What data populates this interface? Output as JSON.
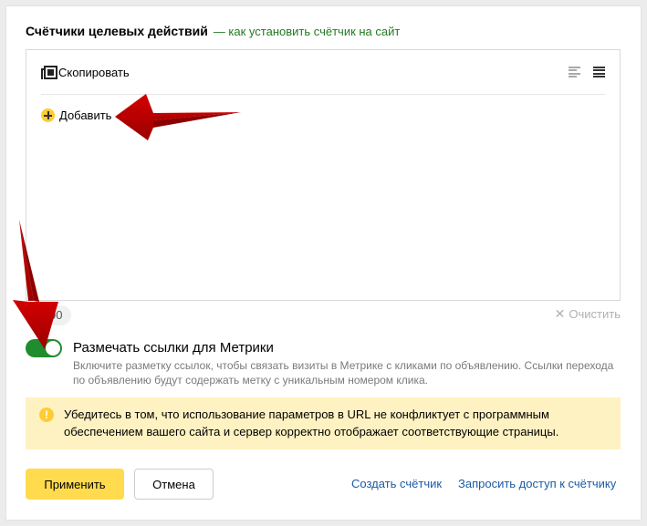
{
  "header": {
    "title": "Счётчики целевых действий",
    "link": "— как установить счётчик на сайт"
  },
  "editor": {
    "copy_label": "Скопировать",
    "add_label": "Добавить",
    "view_icons": [
      "align-left-icon",
      "align-justify-icon"
    ]
  },
  "counter": {
    "value": "00",
    "clear_label": "Очистить"
  },
  "toggle": {
    "label": "Размечать ссылки для Метрики",
    "on": true,
    "description": "Включите разметку ссылок, чтобы связать визиты в Метрике с кликами по объявлению. Ссылки перехода по объявлению будут содержать метку с уникальным номером клика."
  },
  "warning": {
    "icon": "!",
    "text": "Убедитесь в том, что использование параметров в URL не конфликтует с программным обеспечением вашего сайта и сервер корректно отображает соответствующие страницы."
  },
  "footer": {
    "apply_label": "Применить",
    "cancel_label": "Отмена",
    "create_link": "Создать счётчик",
    "access_link": "Запросить доступ к счётчику"
  },
  "colors": {
    "accent_yellow": "#ffdb4d",
    "toggle_green": "#1f8c2e",
    "link_green": "#227a22",
    "link_blue": "#1a5ba6",
    "warning_bg": "#fff2c2",
    "annotation_red": "#b00000"
  }
}
